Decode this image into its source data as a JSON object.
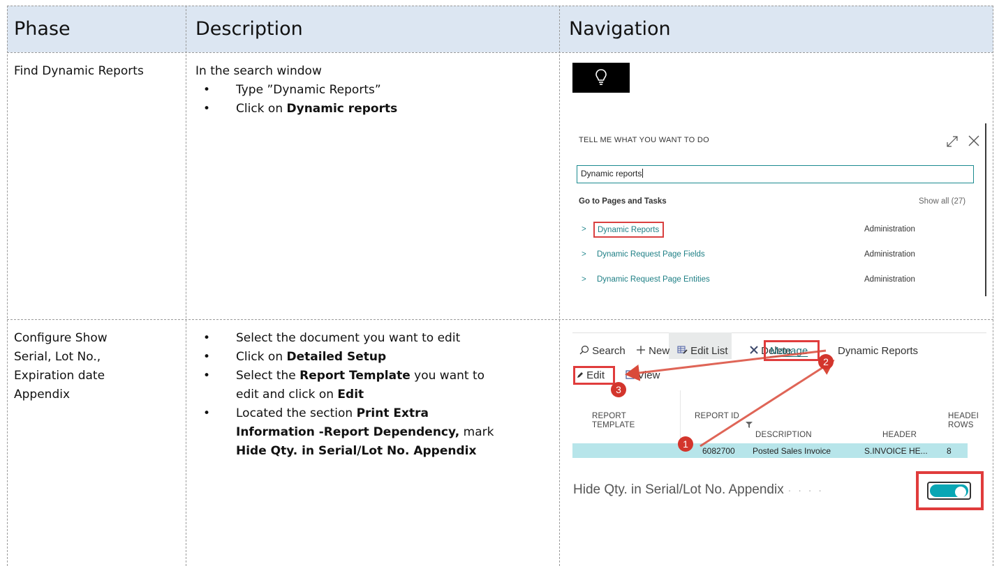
{
  "table": {
    "headers": [
      "Phase",
      "Description",
      "Navigation"
    ]
  },
  "rows": [
    {
      "phase": "Find Dynamic Reports",
      "intro": "In the search window",
      "steps": [
        {
          "plain": "Type ”Dynamic Reports”"
        },
        {
          "pre": "Click on ",
          "bold": "Dynamic reports"
        }
      ]
    },
    {
      "phase_lines": [
        "Configure Show",
        "Serial, Lot No.,",
        "Expiration date",
        "Appendix"
      ],
      "steps": [
        {
          "l1": "Select the document you want to edit"
        },
        {
          "l1_pre": "Click on ",
          "l1_bold": "Detailed Setup"
        },
        {
          "l1_pre": "Select the ",
          "l1_bold": "Report Template",
          "l1_post": " you want to",
          "l2_pre": "edit and click on ",
          "l2_bold": "Edit"
        },
        {
          "l1_pre": "Located the section ",
          "l1_bold": "Print Extra",
          "l2_bold": "Information -Report Dependency,",
          "l2_post": " mark",
          "l3_bold": "Hide Qty. in Serial/Lot No. Appendix"
        }
      ]
    }
  ],
  "tell_me": {
    "title": "TELL ME WHAT YOU WANT TO DO",
    "input_value": "Dynamic reports",
    "section": "Go to Pages and Tasks",
    "show_all": "Show all (27)",
    "results": [
      {
        "label": "Dynamic Reports",
        "category": "Administration"
      },
      {
        "label": "Dynamic Request Page Fields",
        "category": "Administration"
      },
      {
        "label": "Dynamic Request Page Entities",
        "category": "Administration"
      }
    ]
  },
  "list_page": {
    "actions": {
      "search": "Search",
      "new": "New",
      "edit_list": "Edit List",
      "delete": "Delete",
      "manage": "Manage",
      "dynamic_reports": "Dynamic Reports",
      "edit": "Edit",
      "view": "View"
    },
    "columns": {
      "report_template_1": "REPORT",
      "report_template_2": "TEMPLATE",
      "report_id": "REPORT ID",
      "description": "DESCRIPTION",
      "header": "HEADER",
      "header_rows_1": "HEADEI",
      "header_rows_2": "ROWS"
    },
    "row": {
      "report_id": "6082700",
      "description": "Posted Sales Invoice",
      "header": "S.INVOICE HE...",
      "header_rows": "8"
    },
    "badges": [
      "1",
      "2",
      "3"
    ],
    "toggle_label": "Hide Qty. in Serial/Lot No. Appendix",
    "toggle_on": true
  },
  "colors": {
    "header_bg": "#dce6f2",
    "highlight_red": "#e03c3c",
    "teal_link": "#1e7f85",
    "selected_row": "#b7e5ea",
    "toggle_on": "#09a6b4"
  }
}
